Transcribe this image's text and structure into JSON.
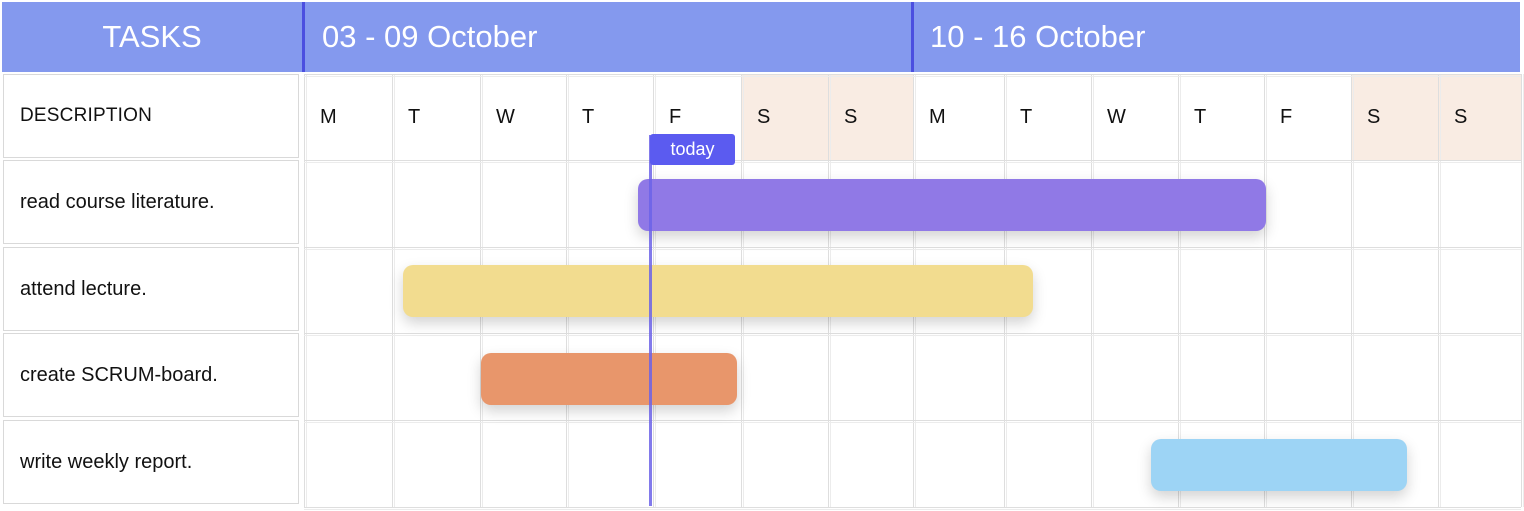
{
  "header": {
    "tasks_label": "TASKS",
    "week1_label": "03 - 09 October",
    "week2_label": "10 - 16 October",
    "background": "#8499ee",
    "separator_color": "#4b4fe0"
  },
  "description_label": "DESCRIPTION",
  "days": [
    "M",
    "T",
    "W",
    "T",
    "F",
    "S",
    "S",
    "M",
    "T",
    "W",
    "T",
    "F",
    "S",
    "S"
  ],
  "weekend_color": "#f9ece3",
  "today": {
    "label": "today",
    "color": "#5b5bf0"
  },
  "tasks": [
    {
      "label": "read course literature.",
      "color": "#9079e6"
    },
    {
      "label": "attend lecture.",
      "color": "#f2dc8f"
    },
    {
      "label": "create SCRUM-board.",
      "color": "#e8966b"
    },
    {
      "label": "write weekly report.",
      "color": "#9dd4f5"
    }
  ]
}
